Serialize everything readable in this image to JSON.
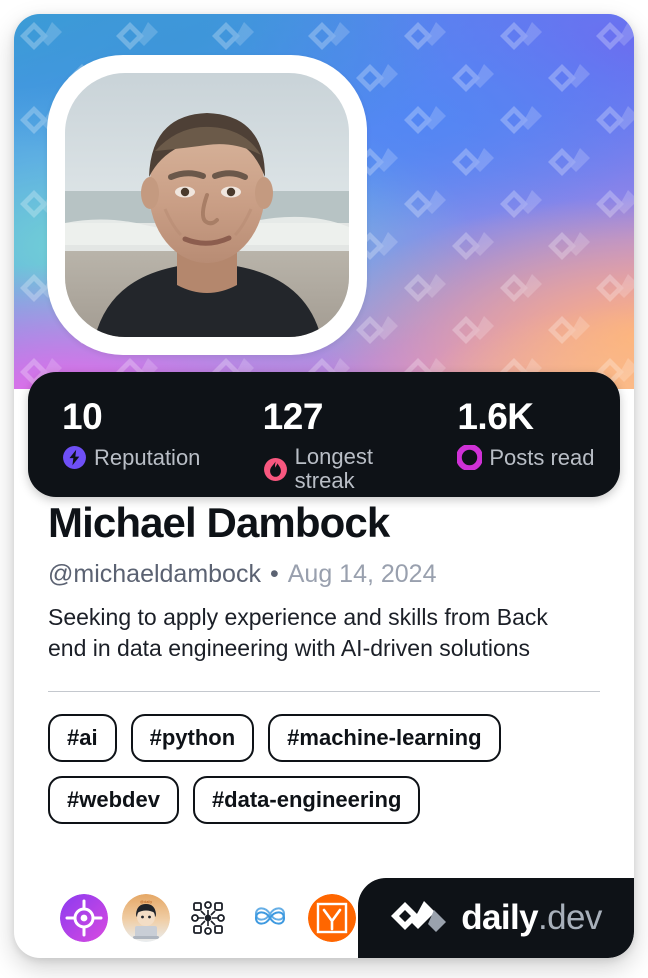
{
  "card": {
    "type": "daily.dev developer profile card"
  },
  "cover": {
    "pattern_icon": "daily-dev-logo-watermark",
    "colors": [
      "#3a9fd4",
      "#4f92ef",
      "#5b8ff2",
      "#8e8ae8",
      "#c489d9",
      "#e9a0b8",
      "#ffc480"
    ]
  },
  "avatar": {
    "alt": "Portrait photo of a man at the beach"
  },
  "stats": [
    {
      "value": "10",
      "label": "Reputation",
      "icon": "reputation-bolt-icon",
      "color": "#6e4ff6"
    },
    {
      "value": "127",
      "label": "Longest streak",
      "icon": "streak-flame-icon",
      "color": "#f8577f"
    },
    {
      "value": "1.6K",
      "label": "Posts read",
      "icon": "posts-read-ring-icon",
      "color": "#cf31d6"
    }
  ],
  "profile": {
    "name": "Michael Dambock",
    "handle": "@michaeldambock",
    "separator": "•",
    "joined": "Aug 14, 2024",
    "bio": "Seeking to apply experience and skills from Back end in data engineering with AI-driven solutions"
  },
  "tags": [
    "#ai",
    "#python",
    "#machine-learning",
    "#webdev",
    "#data-engineering"
  ],
  "badges": [
    {
      "name": "target-badge",
      "title": "Target badge"
    },
    {
      "name": "avatar-badge",
      "title": "Memoji badge"
    },
    {
      "name": "network-badge",
      "title": "Network badge"
    },
    {
      "name": "infinity-badge",
      "title": "Infinity loop badge"
    },
    {
      "name": "ycombinator-badge",
      "title": "Y Combinator badge"
    }
  ],
  "logo": {
    "mark": "daily-dev-chevron-logo",
    "word": "daily",
    "suffix": ".dev"
  }
}
